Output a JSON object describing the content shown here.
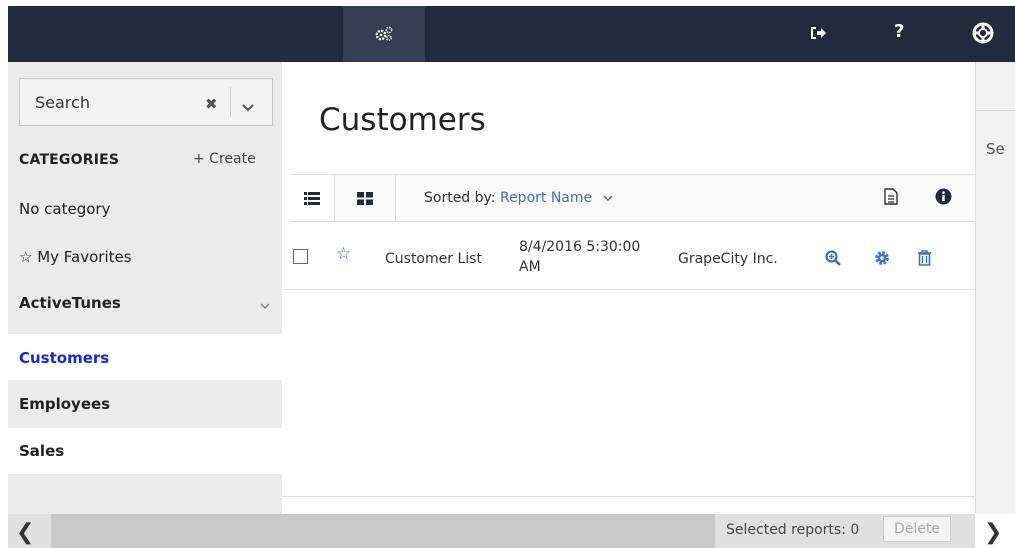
{
  "topbar": {
    "icons": [
      "settings-gears-icon",
      "logout-icon",
      "help-icon",
      "support-lifebuoy-icon"
    ],
    "help_label": "?"
  },
  "sidebar": {
    "search": {
      "placeholder": "Search",
      "clear_glyph": "✖"
    },
    "categories_heading": "CATEGORIES",
    "create_label": "+ Create",
    "no_category": "No category",
    "favorites": "☆ My Favorites",
    "group": {
      "label": "ActiveTunes",
      "caret": "⌄"
    },
    "items": [
      {
        "label": "Customers",
        "selected": true
      },
      {
        "label": "Employees",
        "selected": false
      },
      {
        "label": "Sales",
        "selected": false
      }
    ]
  },
  "main": {
    "title": "Customers",
    "toolbar": {
      "sorted_prefix": "Sorted by: ",
      "sorted_value": "Report Name",
      "sorted_caret": "⌄"
    },
    "reports": [
      {
        "name": "Customer List",
        "date": "8/4/2016 5:30:00 AM",
        "author": "GrapeCity Inc.",
        "star": "☆"
      }
    ]
  },
  "right_panel": {
    "partial_text": "Se"
  },
  "footer": {
    "selected_label": "Selected reports: 0",
    "delete_label": "Delete",
    "scroll_left": "❮",
    "scroll_right": "❯"
  },
  "colors": {
    "topbar_bg": "#232a3d",
    "accent_blue": "#3e6fd0",
    "selected_link": "#1a25d6"
  }
}
